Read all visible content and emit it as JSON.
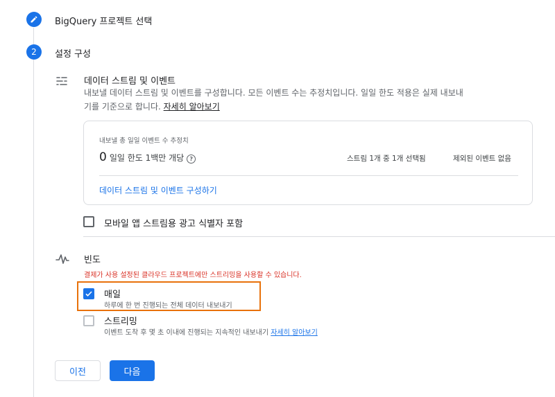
{
  "step1": {
    "title": "BigQuery 프로젝트 선택"
  },
  "step2": {
    "number": "2",
    "title": "설정 구성"
  },
  "datastream": {
    "title": "데이터 스트림 및 이벤트",
    "desc1": "내보낼 데이터 스트림 및 이벤트를 구성합니다. 모든 이벤트 수는 추정치입니다. 일일 한도 적용은 실제 내보내",
    "desc2": "기를 기준으로 합니다.",
    "learn_more": "자세히 알아보기"
  },
  "card": {
    "label": "내보낼 총 일일 이벤트 수 추정치",
    "count": "0",
    "limit": "일일 한도 1백만 개당",
    "streams_selected": "스트림 1개 중 1개 선택됨",
    "excluded": "제외된 이벤트 없음",
    "configure_link": "데이터 스트림 및 이벤트 구성하기"
  },
  "mobile_ad_id": {
    "label": "모바일 앱 스트림용 광고 식별자 포함",
    "checked": false
  },
  "frequency": {
    "title": "빈도",
    "warning": "결제가 사용 설정된 클라우드 프로젝트에만 스트리밍을 사용할 수 있습니다.",
    "daily": {
      "label": "매일",
      "desc": "하루에 한 번 진행되는 전체 데이터 내보내기",
      "checked": true
    },
    "streaming": {
      "label": "스트리밍",
      "desc": "이벤트 도착 후 몇 초 이내에 진행되는 지속적인 내보내기",
      "learn_more": "자세히 알아보기",
      "checked": false
    }
  },
  "buttons": {
    "prev": "이전",
    "next": "다음"
  },
  "colors": {
    "accent": "#1a73e8",
    "warning": "#d93025",
    "highlight": "#e8710a"
  }
}
